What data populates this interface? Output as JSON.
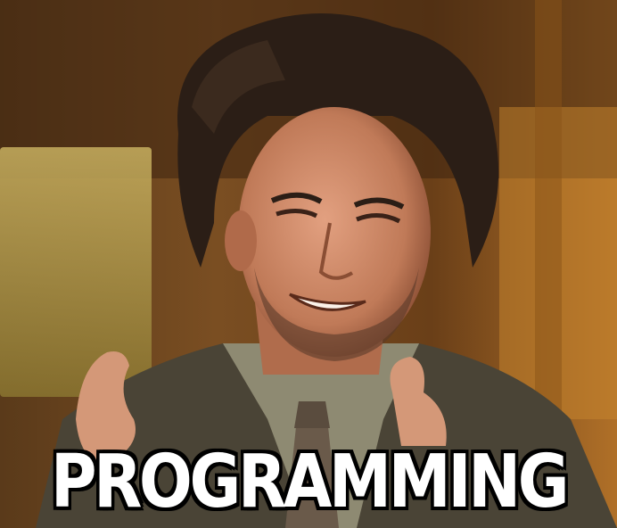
{
  "meme": {
    "caption": "PROGRAMMING"
  }
}
